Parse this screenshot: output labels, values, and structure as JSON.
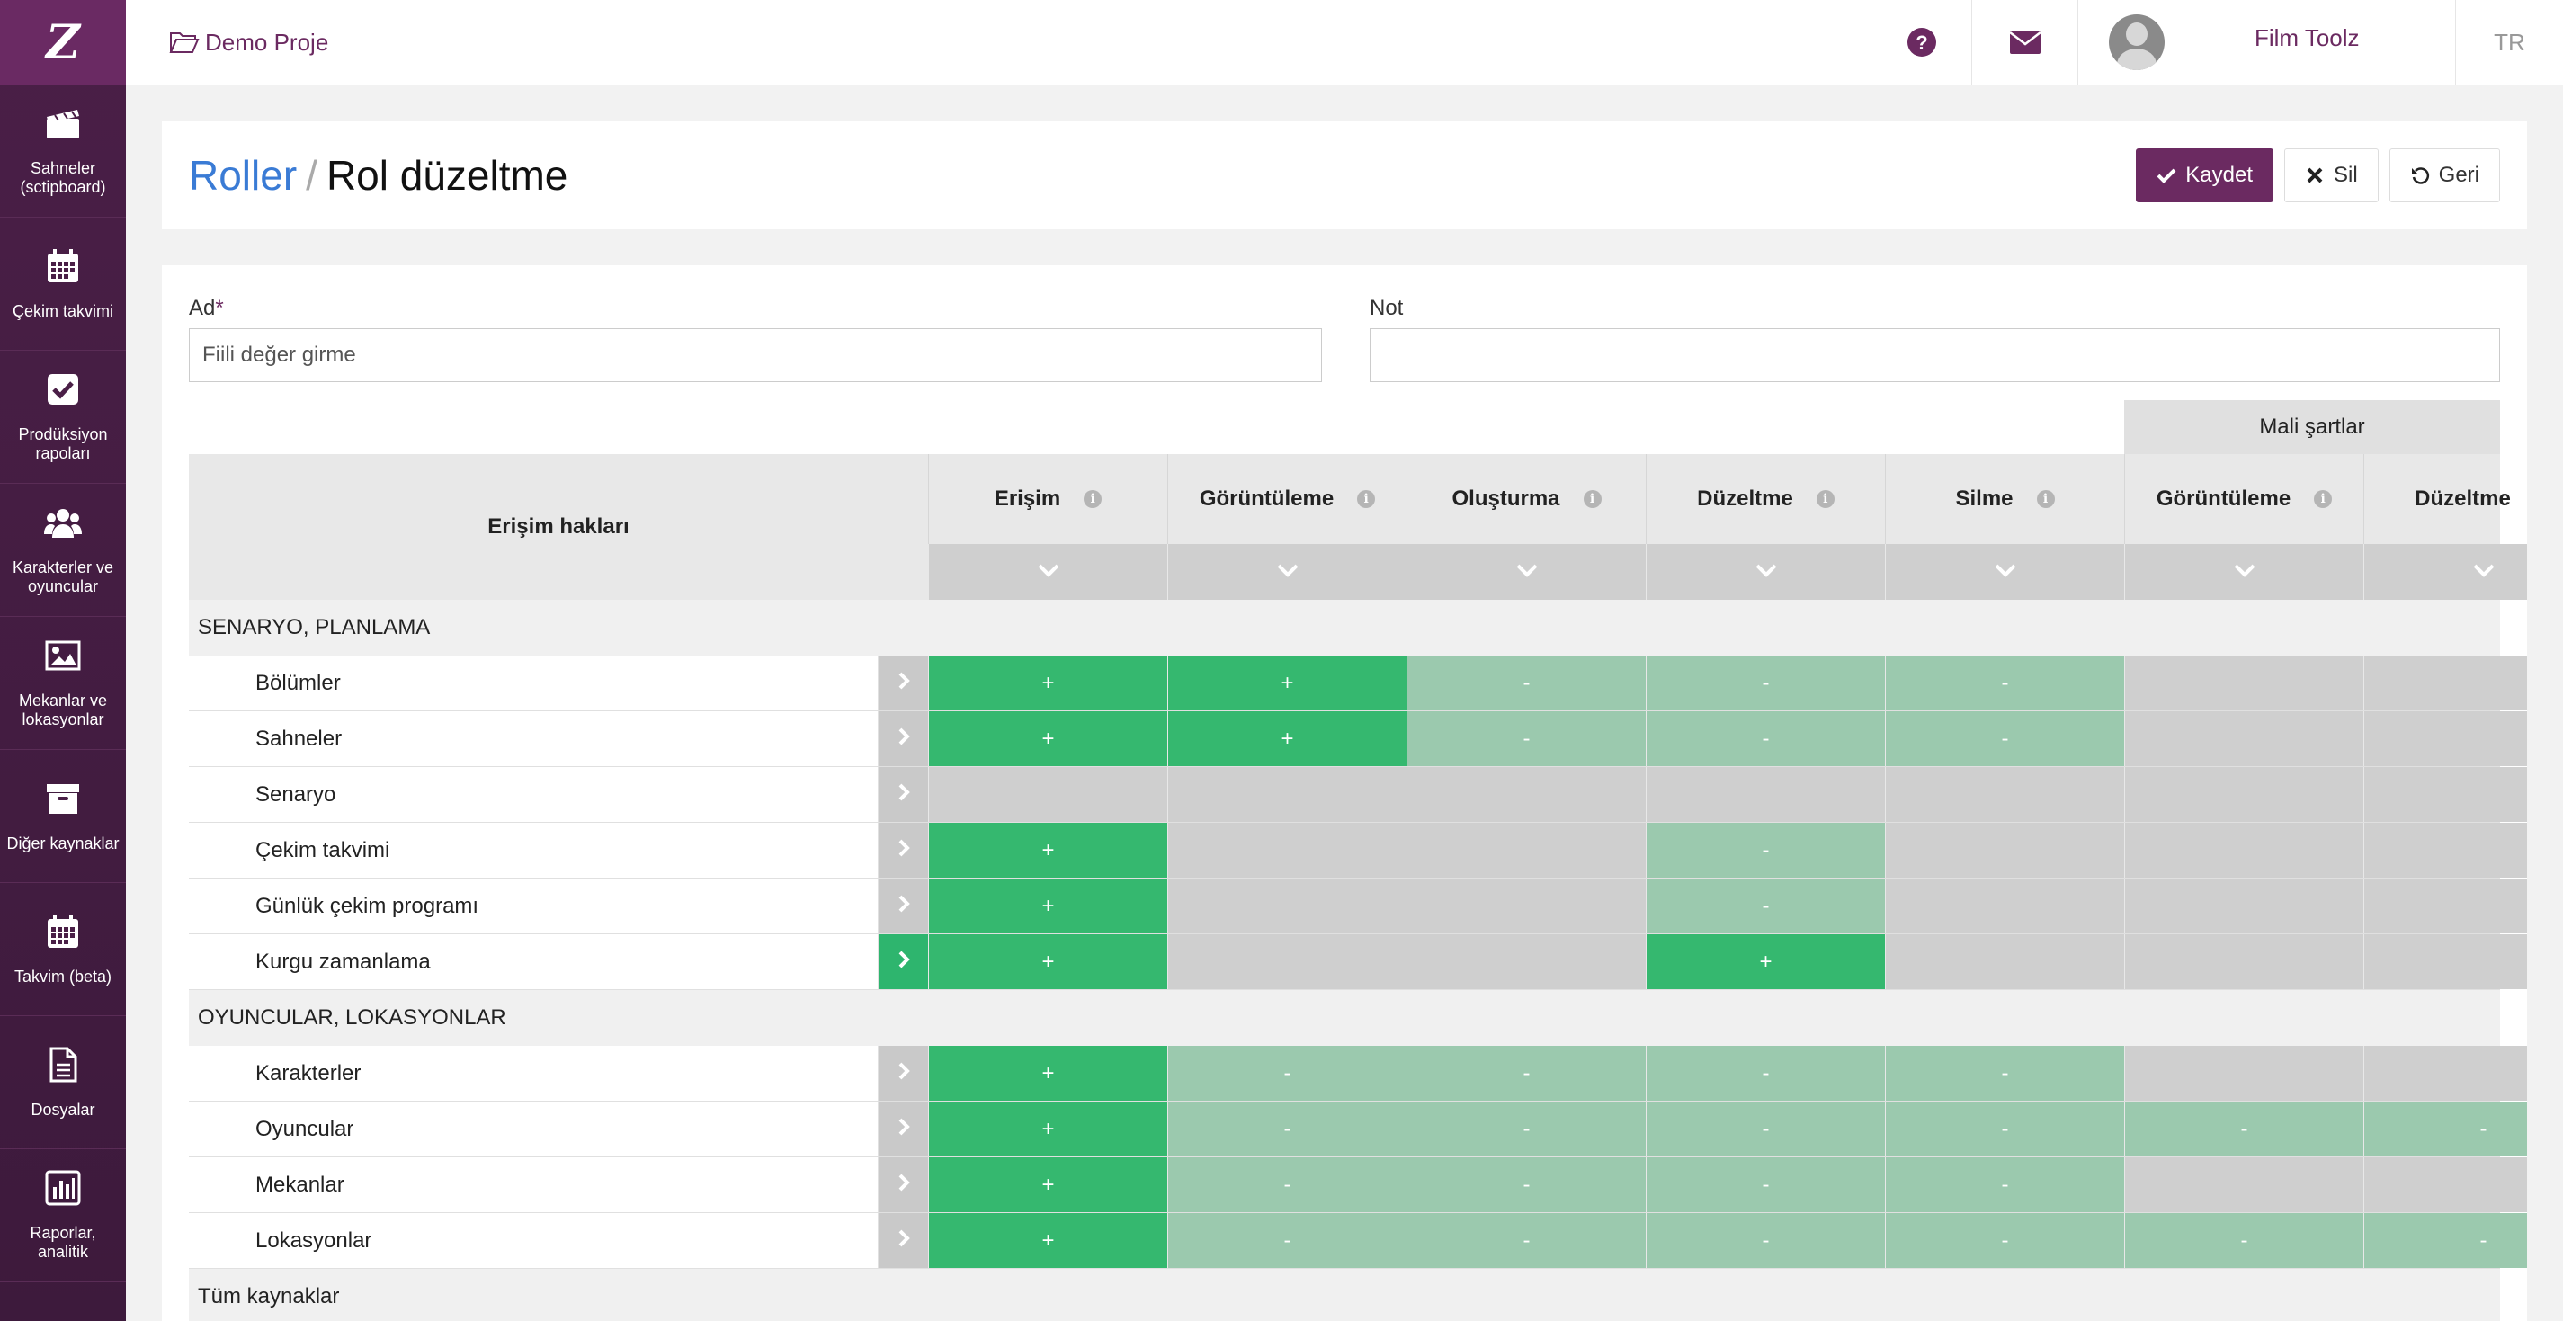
{
  "app": {
    "logo_text": "Z",
    "project": "Demo Proje",
    "user_name": "Film Toolz",
    "lang": "TR"
  },
  "sidebar": {
    "items": [
      {
        "label": "Sahneler (sctipboard)",
        "icon": "clapperboard-icon"
      },
      {
        "label": "Çekim takvimi",
        "icon": "calendar-icon"
      },
      {
        "label": "Prodüksiyon rapoları",
        "icon": "checkbox-icon"
      },
      {
        "label": "Karakterler ve oyuncular",
        "icon": "users-icon"
      },
      {
        "label": "Mekanlar ve lokasyonlar",
        "icon": "image-icon"
      },
      {
        "label": "Diğer kaynaklar",
        "icon": "archive-icon"
      },
      {
        "label": "Takvim (beta)",
        "icon": "calendar-icon"
      },
      {
        "label": "Dosyalar",
        "icon": "file-icon"
      },
      {
        "label": "Raporlar, analitik",
        "icon": "bar-chart-icon"
      }
    ]
  },
  "header": {
    "breadcrumb_link": "Roller",
    "breadcrumb_sep": "/",
    "title": "Rol düzeltme",
    "save": "Kaydet",
    "delete": "Sil",
    "back": "Geri"
  },
  "form": {
    "name_label": "Ad",
    "name_required": "*",
    "name_value": "Fiili değer girme",
    "note_label": "Not",
    "note_value": ""
  },
  "table": {
    "row_header": "Erişim hakları",
    "group_header": "Mali şartlar",
    "columns": [
      "Erişim",
      "Görüntüleme",
      "Oluşturma",
      "Düzeltme",
      "Silme",
      "Görüntüleme",
      "Düzeltme"
    ],
    "sections": [
      {
        "title": "SENARYO, PLANLAMA",
        "rows": [
          {
            "name": "Bölümler",
            "arrow_active": false,
            "cells": [
              "+",
              "+",
              "-",
              "-",
              "-",
              "",
              ""
            ]
          },
          {
            "name": "Sahneler",
            "arrow_active": false,
            "cells": [
              "+",
              "+",
              "-",
              "-",
              "-",
              "",
              ""
            ]
          },
          {
            "name": "Senaryo",
            "arrow_active": false,
            "cells": [
              "",
              "",
              "",
              "",
              "",
              "",
              ""
            ]
          },
          {
            "name": "Çekim takvimi",
            "arrow_active": false,
            "cells": [
              "+",
              "",
              "",
              "-",
              "",
              "",
              ""
            ]
          },
          {
            "name": "Günlük çekim programı",
            "arrow_active": false,
            "cells": [
              "+",
              "",
              "",
              "-",
              "",
              "",
              ""
            ]
          },
          {
            "name": "Kurgu zamanlama",
            "arrow_active": true,
            "cells": [
              "+",
              "",
              "",
              "+",
              "",
              "",
              ""
            ]
          }
        ]
      },
      {
        "title": "OYUNCULAR, LOKASYONLAR",
        "rows": [
          {
            "name": "Karakterler",
            "arrow_active": false,
            "cells": [
              "+",
              "-",
              "-",
              "-",
              "-",
              "",
              ""
            ]
          },
          {
            "name": "Oyuncular",
            "arrow_active": false,
            "cells": [
              "+",
              "-",
              "-",
              "-",
              "-",
              "-",
              "-"
            ]
          },
          {
            "name": "Mekanlar",
            "arrow_active": false,
            "cells": [
              "+",
              "-",
              "-",
              "-",
              "-",
              "",
              ""
            ]
          },
          {
            "name": "Lokasyonlar",
            "arrow_active": false,
            "cells": [
              "+",
              "-",
              "-",
              "-",
              "-",
              "-",
              "-"
            ]
          }
        ]
      },
      {
        "title": "Tüm kaynaklar",
        "rows": []
      }
    ]
  },
  "colors": {
    "brand": "#6b2a61",
    "link": "#3a7bd5",
    "granted": "#35b86f",
    "partial": "#9bc9ae",
    "none": "#cfcfcf"
  }
}
